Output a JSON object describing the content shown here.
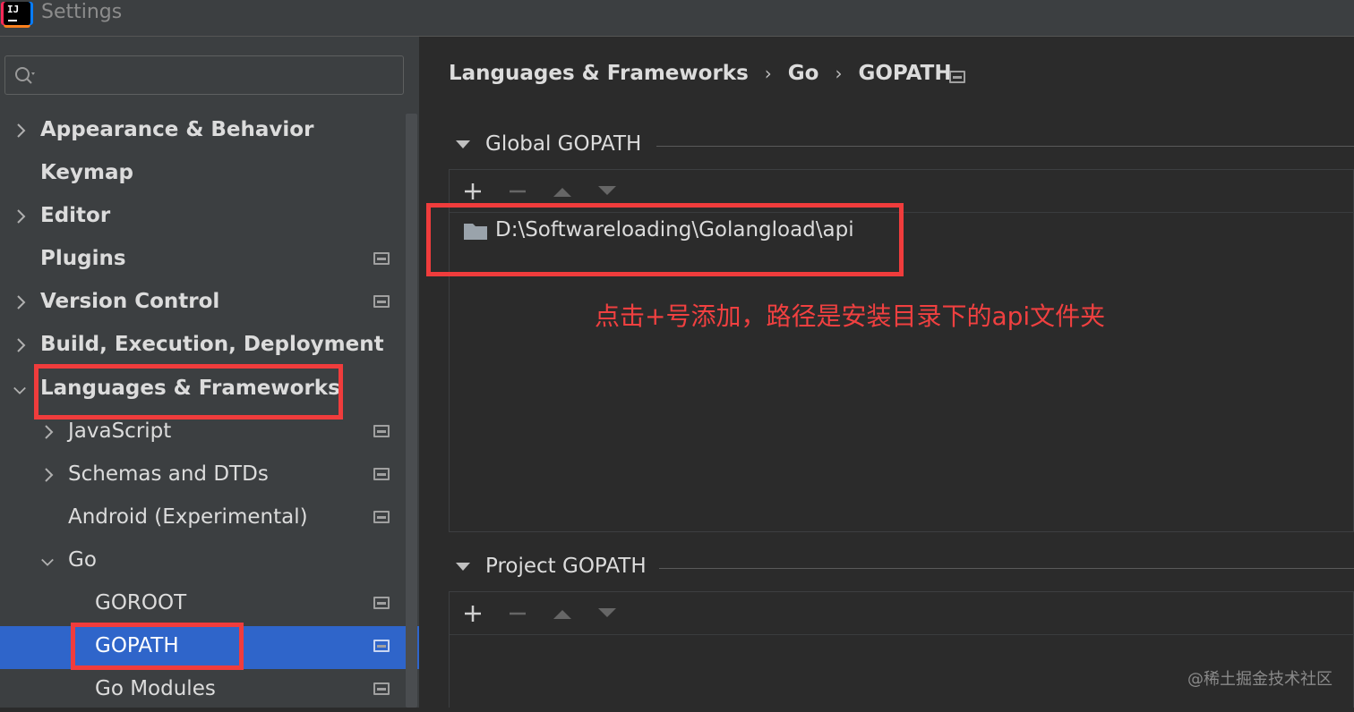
{
  "window": {
    "title": "Settings",
    "app_logo_text": "IJ"
  },
  "search": {
    "placeholder": ""
  },
  "sidebar": {
    "items": [
      {
        "label": "Appearance & Behavior"
      },
      {
        "label": "Keymap"
      },
      {
        "label": "Editor"
      },
      {
        "label": "Plugins"
      },
      {
        "label": "Version Control"
      },
      {
        "label": "Build, Execution, Deployment"
      },
      {
        "label": "Languages & Frameworks"
      },
      {
        "label": "JavaScript"
      },
      {
        "label": "Schemas and DTDs"
      },
      {
        "label": "Android (Experimental)"
      },
      {
        "label": "Go"
      },
      {
        "label": "GOROOT"
      },
      {
        "label": "GOPATH"
      },
      {
        "label": "Go Modules"
      }
    ]
  },
  "breadcrumb": {
    "items": [
      "Languages & Frameworks",
      "Go",
      "GOPATH"
    ]
  },
  "global_gopath": {
    "title": "Global GOPATH",
    "paths": [
      "D:\\Softwareloading\\Golangload\\api"
    ]
  },
  "project_gopath": {
    "title": "Project GOPATH"
  },
  "annotation": "点击+号添加，路径是安装目录下的api文件夹",
  "watermark": "@稀土掘金技术社区",
  "colors": {
    "accent": "#2f65ca",
    "highlight": "#f03c3c"
  }
}
